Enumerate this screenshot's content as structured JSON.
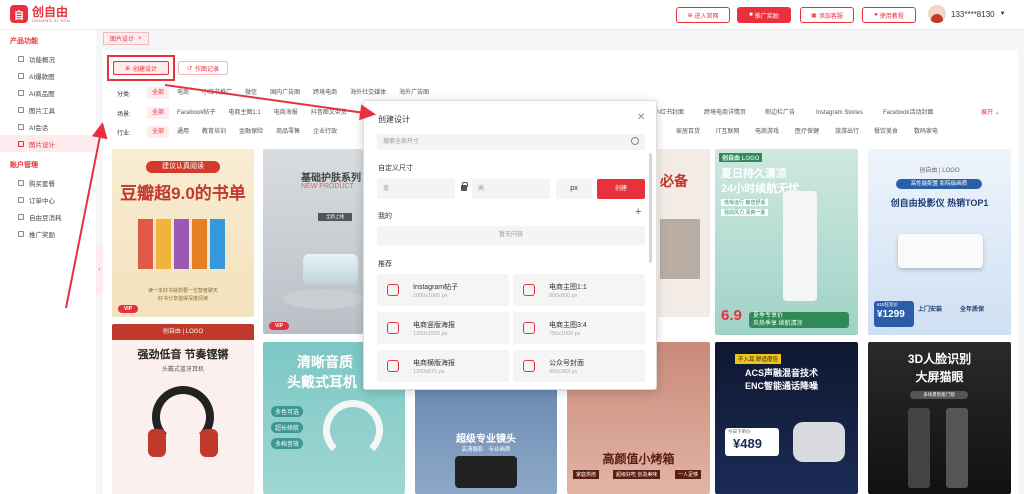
{
  "brand": {
    "name_cn": "创自由",
    "name_en": "CHUANG ZI YOU"
  },
  "header": {
    "buttons": [
      {
        "label": "进入官网",
        "style": "outline"
      },
      {
        "label": "推广奖励",
        "style": "solid"
      },
      {
        "label": "添加客服",
        "style": "outline"
      },
      {
        "label": "使用教程",
        "style": "outline"
      }
    ],
    "user": "133****8130"
  },
  "sidebar": {
    "sections": [
      {
        "title": "产品功能",
        "items": [
          "功能概况",
          "AI爆款图",
          "AI商品图",
          "图片工具",
          "AI会话",
          "图片设计"
        ]
      },
      {
        "title": "账户管理",
        "items": [
          "购买套餐",
          "订单中心",
          "自由豆消耗",
          "推广奖励"
        ]
      }
    ],
    "active": "图片设计"
  },
  "tabs": [
    {
      "label": "图片设计",
      "close": "×"
    }
  ],
  "actions": {
    "create": "创建设计",
    "records": "作图记录"
  },
  "filters": {
    "category": {
      "label": "分类:",
      "items": [
        "全部",
        "电商",
        "小红书推广",
        "微信",
        "国内广告图",
        "跨境电商",
        "海外社交媒体",
        "海外广告图"
      ]
    },
    "scene": {
      "label": "场景:",
      "items": [
        "全部",
        "Facebook帖子",
        "电商主图1:1",
        "电商海报",
        "抖音图文带货",
        "小红书封面",
        "跨境电商详情页",
        "侧边栏广告",
        "Instagram Stories",
        "Facebook活动封面"
      ]
    },
    "industry": {
      "label": "行业:",
      "items": [
        "全部",
        "通用",
        "教育培训",
        "金融保险",
        "商品零售",
        "企业行政",
        "家居百货",
        "IT互联网",
        "电商游戏",
        "医疗保健",
        "旅游出行",
        "餐饮美食",
        "数码家电"
      ]
    },
    "expand": "展开"
  },
  "templates": {
    "vip": "VIP",
    "book": {
      "tag": "建议认真阅读",
      "title": "豆瓣超9.0的书单",
      "caption": "读一本好书就想要一位智者聊天",
      "caption2": "好书分享值得深度阅读"
    },
    "skincare": {
      "title": "基础护肤系列",
      "sub": "NEW PRODUCT",
      "badge": "全新上线"
    },
    "fan": {
      "brand": "创自由",
      "logo": "LOGO",
      "title": "夏日持久清凉",
      "title2": "24小时续航无忧",
      "badge": "低噪运行 静音舒适",
      "badge2": "强劲风力 清爽一夏",
      "bottom": "夏季专享价",
      "bottom2": "炎热季享 续航清凉",
      "percent": "6.9"
    },
    "projector": {
      "brand": "创自由",
      "logo": "LOGO",
      "tag": "高性能配置 影院级画质",
      "title": "创自由投影仪 热销TOP1",
      "price_label": "618狂欢价",
      "price": "¥1299",
      "deal1": "上门安装",
      "deal2": "全年质保"
    },
    "headphone": {
      "brand": "创自由",
      "logo": "LOGO",
      "title": "强劲低音 节奏铿锵",
      "sub": "头戴式蓝牙耳机"
    },
    "headset2": {
      "title": "清晰音质",
      "title2": "头戴式耳机",
      "tags": [
        "多色可选",
        "超长续航",
        "多档音效"
      ]
    },
    "camera": {
      "title": "超级专业镜头",
      "sub": "高清摄影 · 专业画质"
    },
    "oven": {
      "title": "高颜值小烤箱",
      "pills": [
        "家庭烘焙",
        "超级好吃 创造美味",
        "一人足够"
      ]
    },
    "earbuds": {
      "tag": "不入耳 舒适度佳",
      "title": "ACS声融混音技术",
      "title2": "ENC智能通话降噪",
      "price_label": "今日下单价",
      "price": "¥489"
    },
    "lock": {
      "title": "3D人脸识别",
      "title2": "大屏猫眼",
      "tag": "多场景智能门锁"
    },
    "shoe": {
      "text": "必备"
    }
  },
  "modal": {
    "title": "创建设计",
    "close": "✕",
    "search_placeholder": "搜索全部尺寸",
    "custom_label": "自定义尺寸",
    "width_placeholder": "宽",
    "height_placeholder": "高",
    "unit": "px",
    "create": "创建",
    "mine_label": "我的",
    "mine_add": "+",
    "empty": "暂无内容",
    "recommend_label": "推荐",
    "recommend": [
      {
        "name": "Instagram帖子",
        "size": "1080x1080 px"
      },
      {
        "name": "电商主图1:1",
        "size": "800x800 px"
      },
      {
        "name": "电商竖版海报",
        "size": "1200x1920 px"
      },
      {
        "name": "电商主图3:4",
        "size": "750x1000 px"
      },
      {
        "name": "电商横版海报",
        "size": "1200x675 px"
      },
      {
        "name": "公众号封面",
        "size": "900x383 px"
      }
    ]
  }
}
